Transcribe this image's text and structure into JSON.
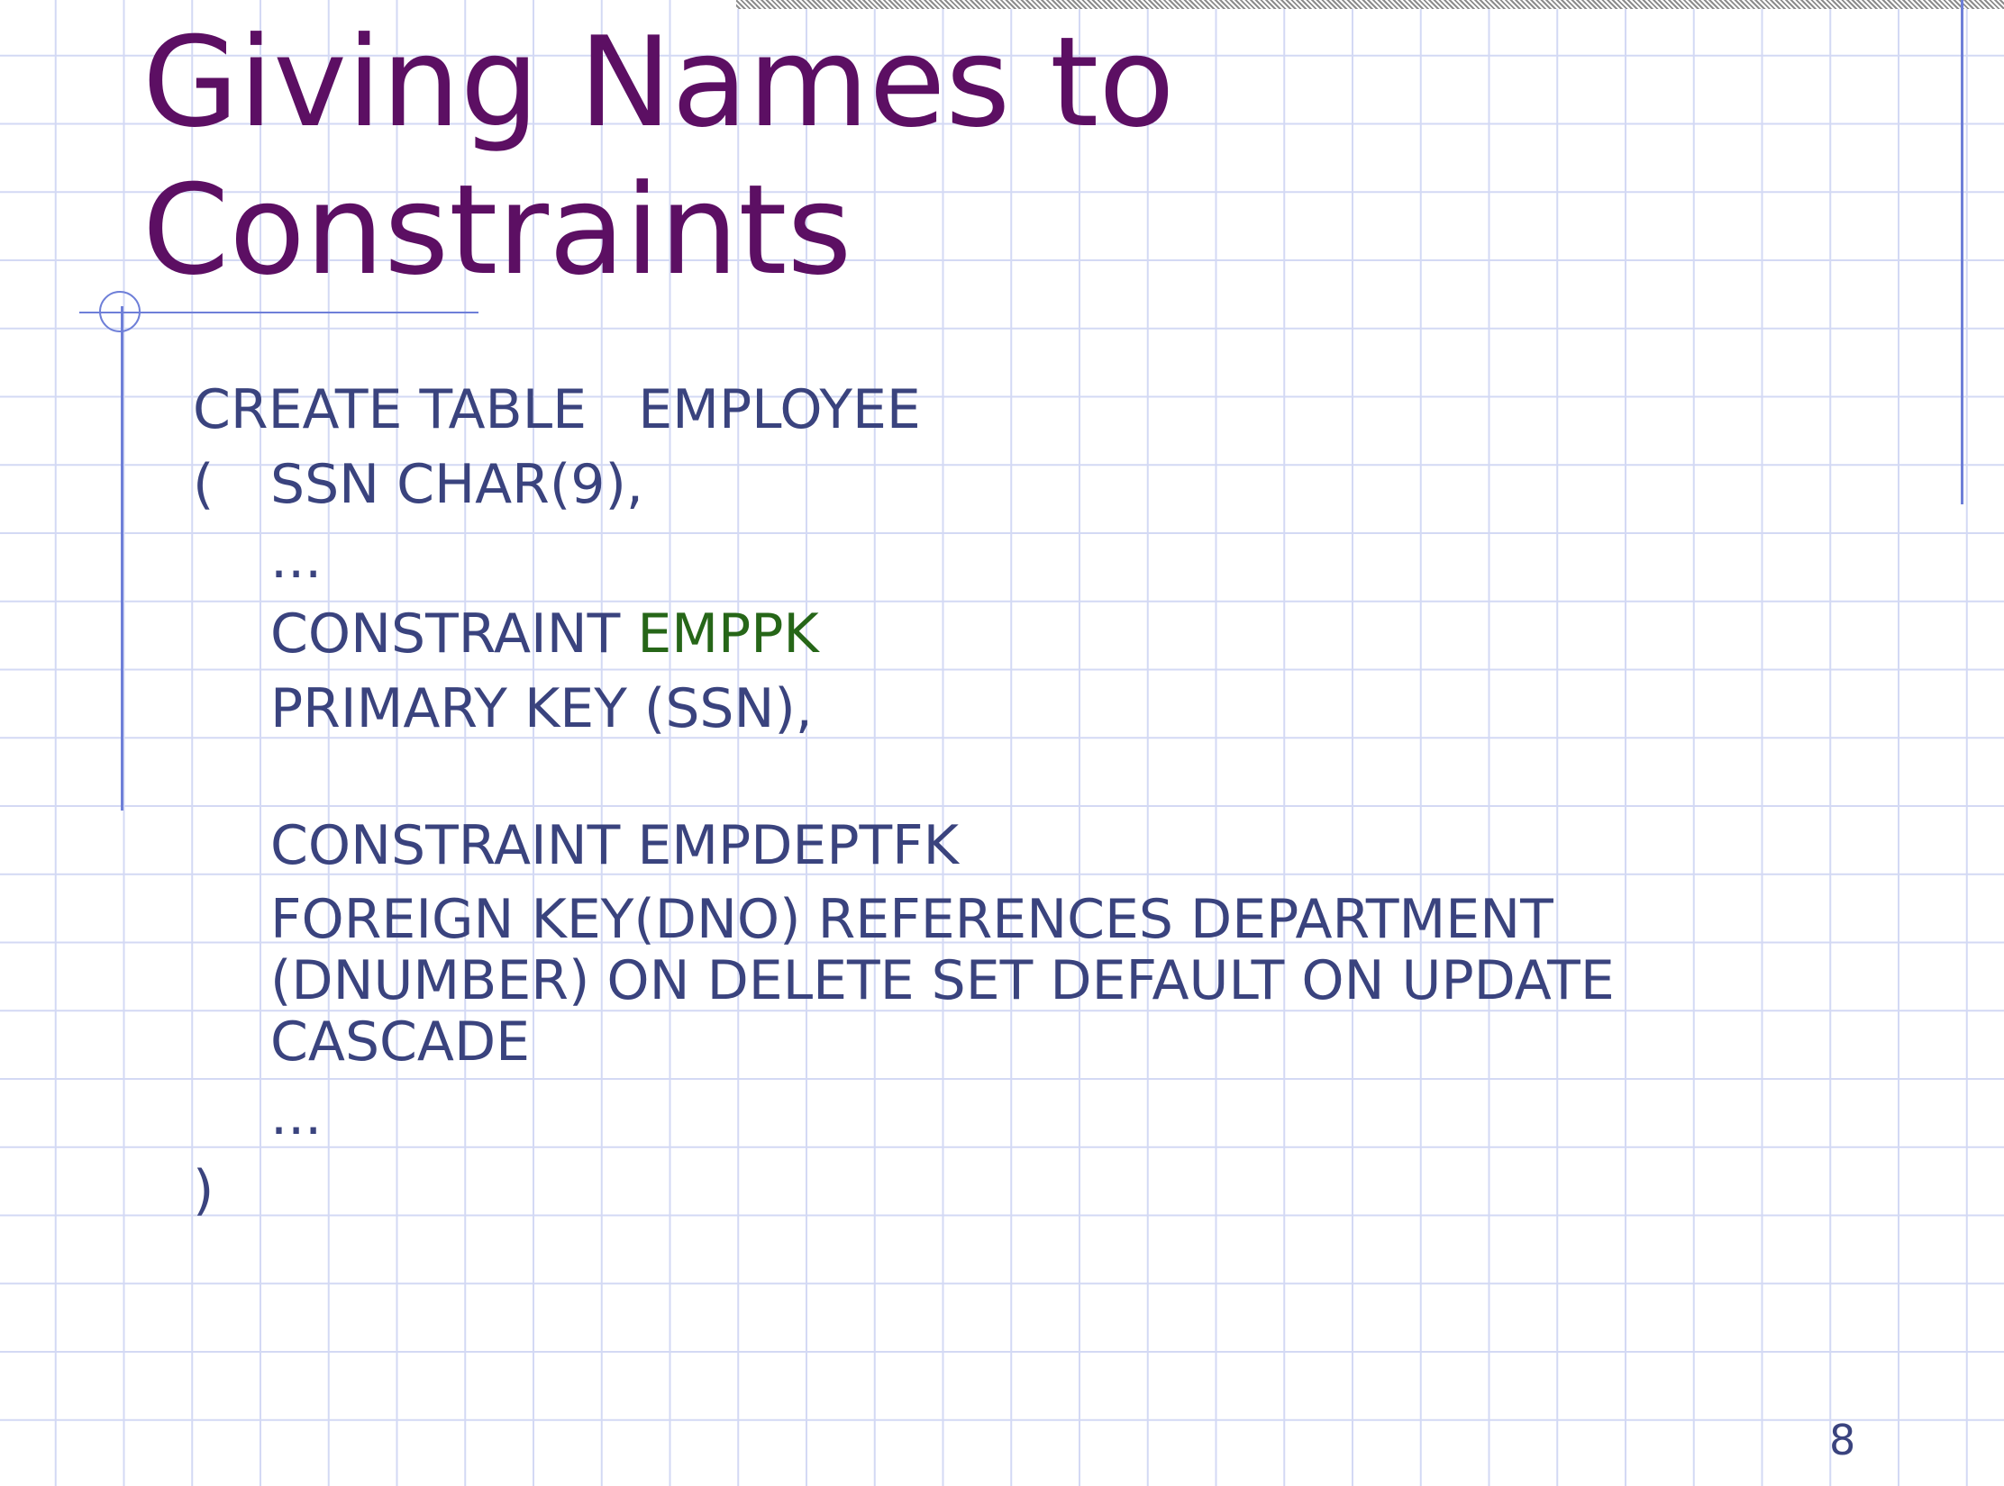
{
  "slide": {
    "title_line1": "Giving Names to",
    "title_line2": "Constraints",
    "page_number": "8"
  },
  "code": {
    "line1": "CREATE TABLE   EMPLOYEE",
    "line2_paren": "(",
    "line2_text": "SSN CHAR(9),",
    "ellipsis1": "...",
    "constraint1_keyword": "CONSTRAINT ",
    "constraint1_name": "EMPPK",
    "primary_key": "PRIMARY KEY (SSN),",
    "constraint2": "CONSTRAINT EMPDEPTFK",
    "foreign_key": "FOREIGN KEY(DNO) REFERENCES DEPARTMENT (DNUMBER) ON DELETE SET DEFAULT ON UPDATE CASCADE",
    "ellipsis2": "...",
    "close_paren": ")"
  },
  "colors": {
    "title": "#5c0f63",
    "body_text": "#3a437e",
    "highlight": "#266618",
    "grid": "#d3d9f4",
    "accent_rule": "#6e7fd8"
  }
}
